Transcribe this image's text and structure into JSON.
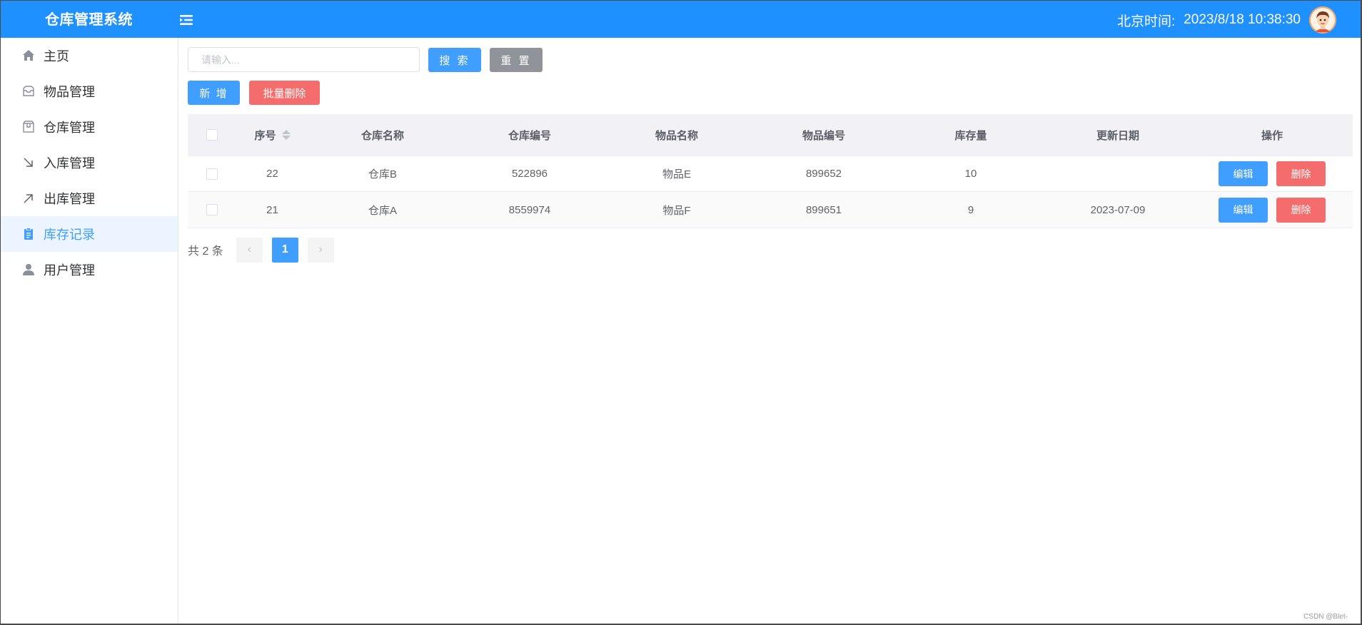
{
  "header": {
    "app_title": "仓库管理系统",
    "time_label": "北京时间:",
    "time_value": "2023/8/18 10:38:30"
  },
  "sidebar": {
    "items": [
      {
        "label": "主页",
        "icon": "home-icon",
        "active": false
      },
      {
        "label": "物品管理",
        "icon": "inbox-icon",
        "active": false
      },
      {
        "label": "仓库管理",
        "icon": "box-icon",
        "active": false
      },
      {
        "label": "入库管理",
        "icon": "arrow-down-right-icon",
        "active": false
      },
      {
        "label": "出库管理",
        "icon": "arrow-up-right-icon",
        "active": false
      },
      {
        "label": "库存记录",
        "icon": "clipboard-icon",
        "active": true
      },
      {
        "label": "用户管理",
        "icon": "user-icon",
        "active": false
      }
    ]
  },
  "toolbar": {
    "search_placeholder": "请输入...",
    "search_label": "搜 索",
    "reset_label": "重 置",
    "add_label": "新 增",
    "batch_delete_label": "批量删除"
  },
  "table": {
    "columns": [
      "序号",
      "仓库名称",
      "仓库编号",
      "物品名称",
      "物品编号",
      "库存量",
      "更新日期",
      "操作"
    ],
    "rows": [
      {
        "id": "22",
        "warehouse_name": "仓库B",
        "warehouse_code": "522896",
        "item_name": "物品E",
        "item_code": "899652",
        "stock": "10",
        "updated": ""
      },
      {
        "id": "21",
        "warehouse_name": "仓库A",
        "warehouse_code": "8559974",
        "item_name": "物品F",
        "item_code": "899651",
        "stock": "9",
        "updated": "2023-07-09"
      }
    ],
    "edit_label": "编辑",
    "delete_label": "删除"
  },
  "pagination": {
    "total_text": "共 2 条",
    "current_page": "1",
    "prev_glyph": "‹",
    "next_glyph": "›"
  },
  "watermark": "CSDN @Blet-",
  "colors": {
    "header_bg": "#1e90ff",
    "primary": "#409eff",
    "danger": "#f56c6c",
    "gray": "#909399",
    "active_menu_bg": "#ecf5ff"
  }
}
